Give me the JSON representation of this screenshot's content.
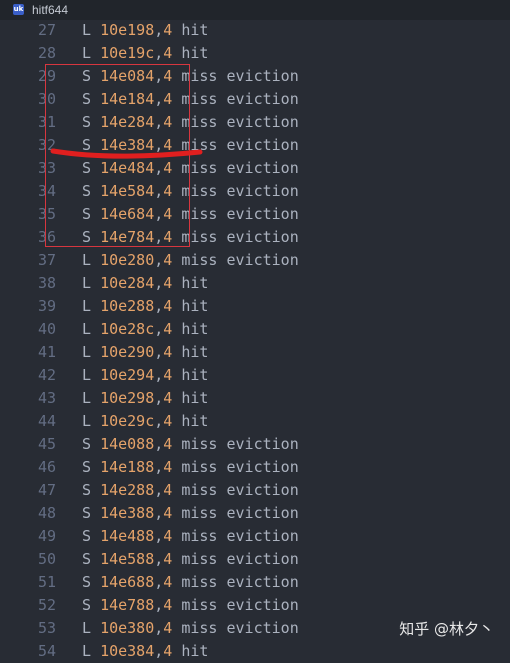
{
  "tab": {
    "title": "hitf644",
    "icon": "file-icon"
  },
  "lines": [
    {
      "num": "27",
      "op": "L",
      "addr": "10e198",
      "size": "4",
      "res": "hit"
    },
    {
      "num": "28",
      "op": "L",
      "addr": "10e19c",
      "size": "4",
      "res": "hit"
    },
    {
      "num": "29",
      "op": "S",
      "addr": "14e084",
      "size": "4",
      "res": "miss eviction"
    },
    {
      "num": "30",
      "op": "S",
      "addr": "14e184",
      "size": "4",
      "res": "miss eviction"
    },
    {
      "num": "31",
      "op": "S",
      "addr": "14e284",
      "size": "4",
      "res": "miss eviction"
    },
    {
      "num": "32",
      "op": "S",
      "addr": "14e384",
      "size": "4",
      "res": "miss eviction"
    },
    {
      "num": "33",
      "op": "S",
      "addr": "14e484",
      "size": "4",
      "res": "miss eviction"
    },
    {
      "num": "34",
      "op": "S",
      "addr": "14e584",
      "size": "4",
      "res": "miss eviction"
    },
    {
      "num": "35",
      "op": "S",
      "addr": "14e684",
      "size": "4",
      "res": "miss eviction"
    },
    {
      "num": "36",
      "op": "S",
      "addr": "14e784",
      "size": "4",
      "res": "miss eviction"
    },
    {
      "num": "37",
      "op": "L",
      "addr": "10e280",
      "size": "4",
      "res": "miss eviction"
    },
    {
      "num": "38",
      "op": "L",
      "addr": "10e284",
      "size": "4",
      "res": "hit"
    },
    {
      "num": "39",
      "op": "L",
      "addr": "10e288",
      "size": "4",
      "res": "hit"
    },
    {
      "num": "40",
      "op": "L",
      "addr": "10e28c",
      "size": "4",
      "res": "hit"
    },
    {
      "num": "41",
      "op": "L",
      "addr": "10e290",
      "size": "4",
      "res": "hit"
    },
    {
      "num": "42",
      "op": "L",
      "addr": "10e294",
      "size": "4",
      "res": "hit"
    },
    {
      "num": "43",
      "op": "L",
      "addr": "10e298",
      "size": "4",
      "res": "hit"
    },
    {
      "num": "44",
      "op": "L",
      "addr": "10e29c",
      "size": "4",
      "res": "hit"
    },
    {
      "num": "45",
      "op": "S",
      "addr": "14e088",
      "size": "4",
      "res": "miss eviction"
    },
    {
      "num": "46",
      "op": "S",
      "addr": "14e188",
      "size": "4",
      "res": "miss eviction"
    },
    {
      "num": "47",
      "op": "S",
      "addr": "14e288",
      "size": "4",
      "res": "miss eviction"
    },
    {
      "num": "48",
      "op": "S",
      "addr": "14e388",
      "size": "4",
      "res": "miss eviction"
    },
    {
      "num": "49",
      "op": "S",
      "addr": "14e488",
      "size": "4",
      "res": "miss eviction"
    },
    {
      "num": "50",
      "op": "S",
      "addr": "14e588",
      "size": "4",
      "res": "miss eviction"
    },
    {
      "num": "51",
      "op": "S",
      "addr": "14e688",
      "size": "4",
      "res": "miss eviction"
    },
    {
      "num": "52",
      "op": "S",
      "addr": "14e788",
      "size": "4",
      "res": "miss eviction"
    },
    {
      "num": "53",
      "op": "L",
      "addr": "10e380",
      "size": "4",
      "res": "miss eviction"
    },
    {
      "num": "54",
      "op": "L",
      "addr": "10e384",
      "size": "4",
      "res": "hit"
    }
  ],
  "annotations": {
    "box_color": "#d7363f",
    "stroke_color": "#e01f1f"
  },
  "watermark": "知乎 @林夕丶",
  "colors": {
    "background": "#282c34",
    "line_number": "#636d83",
    "text": "#abb2bf",
    "number": "#e5a36a"
  }
}
